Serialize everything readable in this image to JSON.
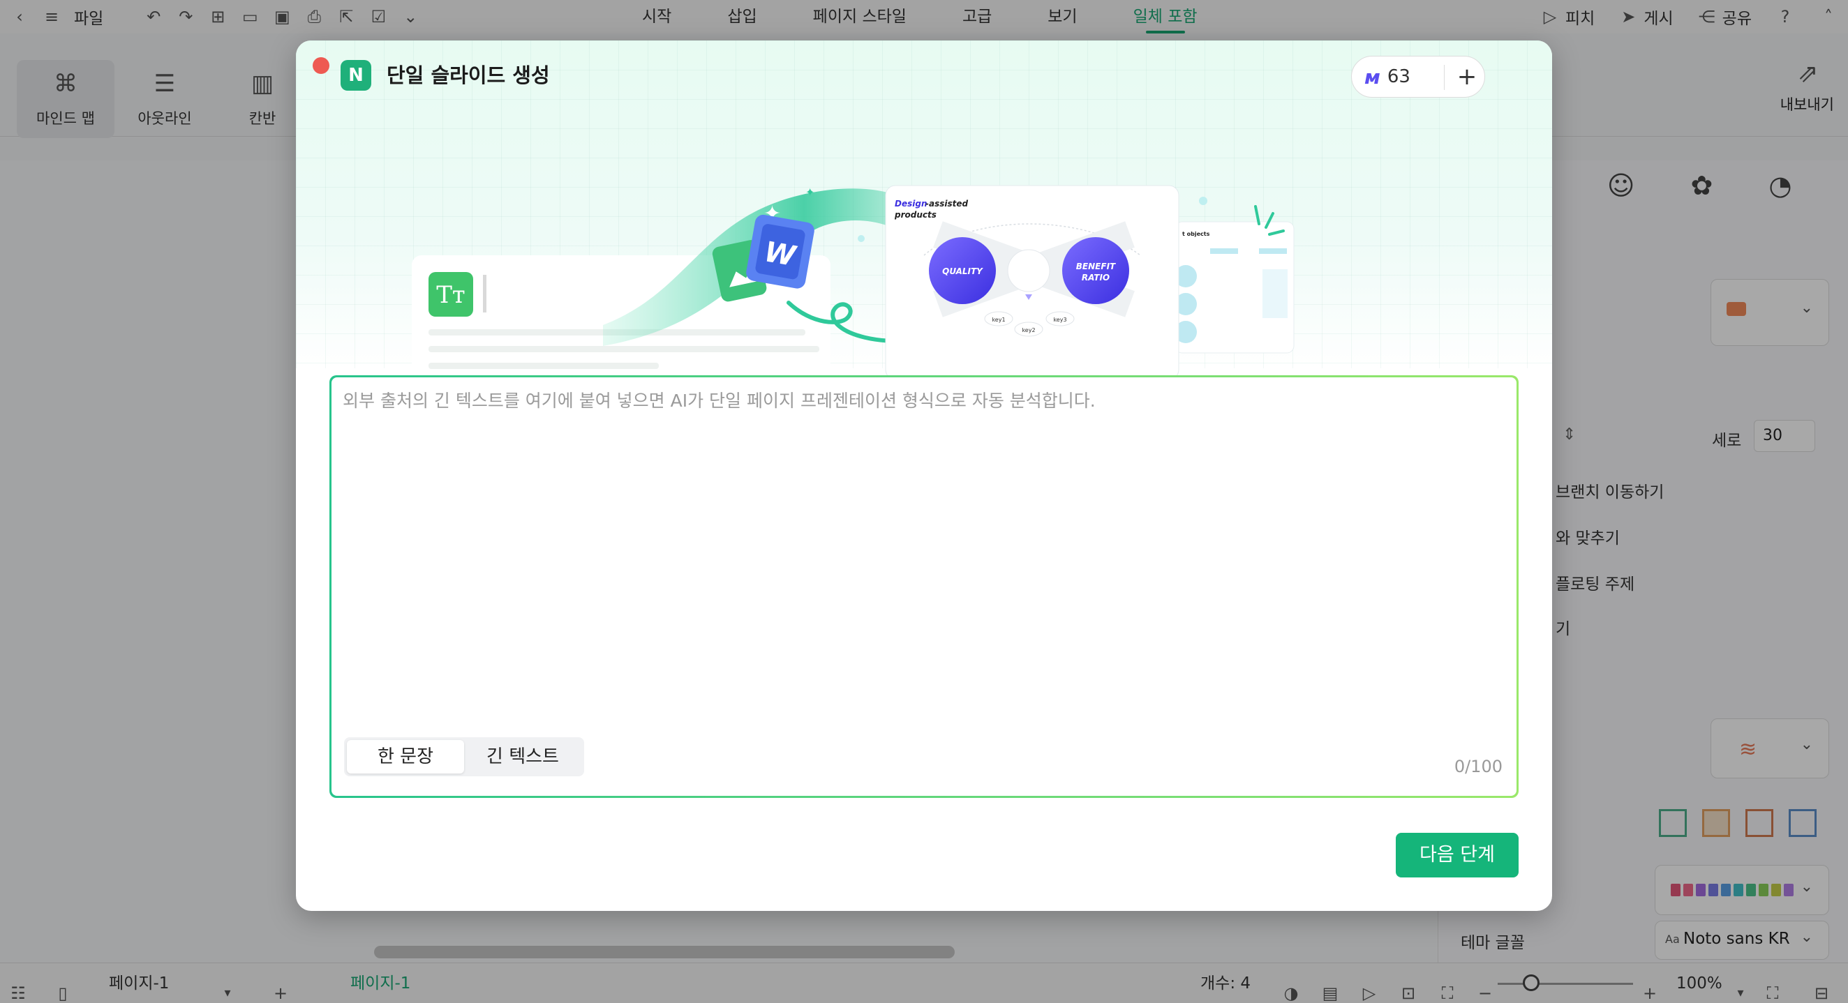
{
  "app": {
    "menubar": {
      "file_label": "파일",
      "tabs": [
        {
          "label": "시작",
          "active": false
        },
        {
          "label": "삽입",
          "active": false
        },
        {
          "label": "페이지 스타일",
          "active": false
        },
        {
          "label": "고급",
          "active": false
        },
        {
          "label": "보기",
          "active": false
        },
        {
          "label": "일체 포함",
          "active": true
        }
      ],
      "pitch_label": "피치",
      "publish_label": "게시",
      "share_label": "공유"
    },
    "views": {
      "mindmap_label": "마인드 맵",
      "outline_label": "아웃라인",
      "kanban_label": "칸반"
    },
    "export_label": "내보내기",
    "right_panel": {
      "vertical_label": "세로",
      "vertical_value": "30",
      "branch_move_label": "브랜치 이동하기",
      "fit_label": "와 맞추기",
      "floating_topic_label": "플로팅 주제",
      "truncated_label": "기",
      "theme_font_label": "테마 글꼴",
      "font_prefix": "Aa",
      "font_value": "Noto sans KR",
      "swatch_colors": [
        "#e4577a",
        "#ef6a8a",
        "#a36de0",
        "#7a7de6",
        "#5aa0e6",
        "#43c0c8",
        "#4cc28a",
        "#8ad05a",
        "#c5cf4a",
        "#b07ee6"
      ]
    },
    "statusbar": {
      "page_select": "페이지-1",
      "page_tab": "페이지-1",
      "count_label": "개수: 4",
      "zoom": "100%"
    }
  },
  "modal": {
    "title": "단일 슬라이드 생성",
    "credits": "63",
    "placeholder": "외부 출처의 긴 텍스트를 여기에 붙여 넣으면 AI가 단일 페이지 프레젠테이션 형식으로 자동 분석합니다.",
    "modes": [
      {
        "label": "한 문장",
        "active": true
      },
      {
        "label": "긴 텍스트",
        "active": false
      }
    ],
    "counter": "0/100",
    "next_label": "다음 단계",
    "accent": "#15b57a",
    "illustration": {
      "slide_title_a": "Design",
      "slide_title_b": "-assisted",
      "slide_title_c": "products",
      "bubble_left": "QUALITY",
      "bubble_right_1": "BENEFIT",
      "bubble_right_2": "RATIO",
      "key1": "key1",
      "key2": "key2",
      "key3": "key3",
      "word_badge": "W",
      "text_badge": "Tт",
      "side_slide_title": "t objects"
    }
  }
}
